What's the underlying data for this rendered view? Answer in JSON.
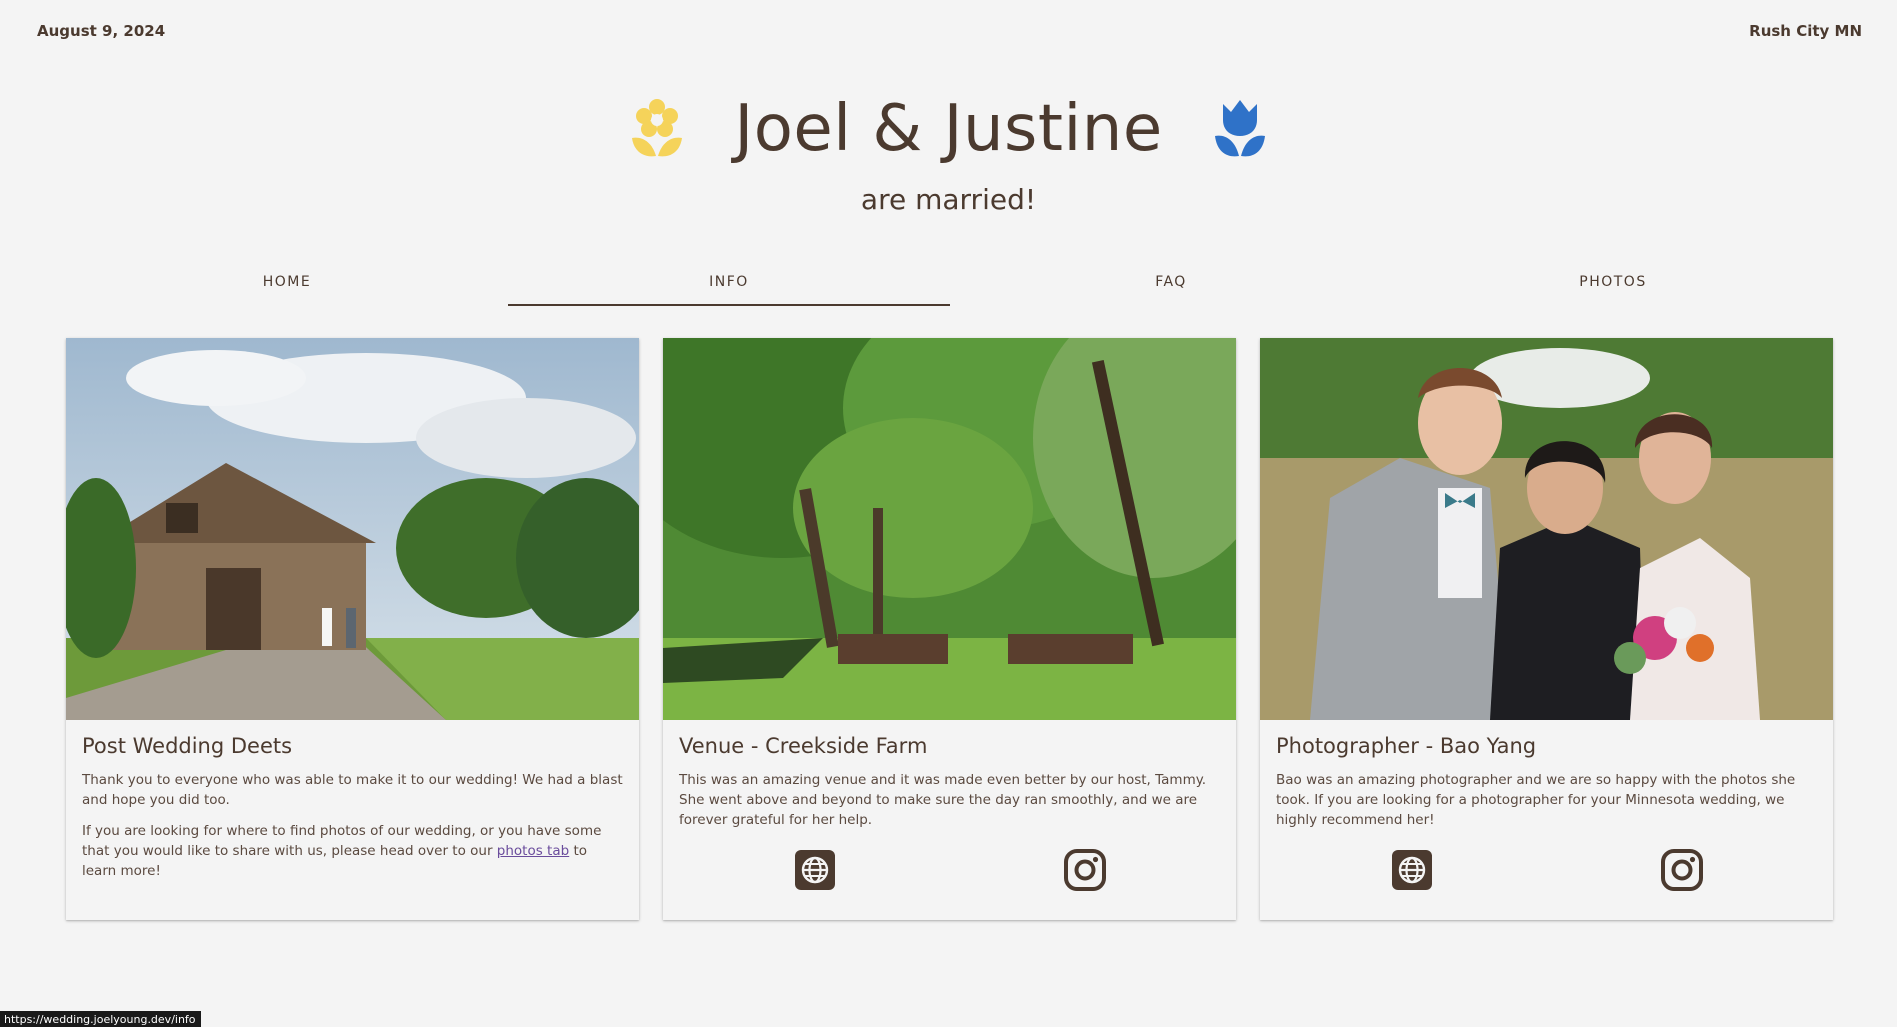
{
  "header": {
    "date": "August 9, 2024",
    "location": "Rush City MN"
  },
  "hero": {
    "title": "Joel & Justine",
    "subtitle": "are married!",
    "left_icon": "yellow-flower-icon",
    "right_icon": "blue-tulip-icon",
    "left_color": "#f5d35a",
    "right_color": "#2f72c8"
  },
  "nav": {
    "tabs": [
      {
        "label": "HOME"
      },
      {
        "label": "INFO"
      },
      {
        "label": "FAQ"
      },
      {
        "label": "PHOTOS"
      }
    ],
    "active_tab": "INFO"
  },
  "cards": [
    {
      "title": "Post Wedding Deets",
      "paragraph1": "Thank you to everyone who was able to make it to our wedding! We had a blast and hope you did too.",
      "paragraph2_before": "If you are looking for where to find photos of our wedding, or you have some that you would like to share with us, please head over to our ",
      "paragraph2_link": "photos tab",
      "paragraph2_after": " to learn more!"
    },
    {
      "title": "Venue - Creekside Farm",
      "paragraph1": "This was an amazing venue and it was made even better by our host, Tammy. She went above and beyond to make sure the day ran smoothly, and we are forever grateful for her help.",
      "icons": [
        "globe-icon",
        "instagram-icon"
      ]
    },
    {
      "title": "Photographer - Bao Yang",
      "paragraph1": "Bao was an amazing photographer and we are so happy with the photos she took. If you are looking for a photographer for your Minnesota wedding, we highly recommend her!",
      "icons": [
        "globe-icon",
        "instagram-icon"
      ]
    }
  ],
  "status_bar": {
    "url": "https://wedding.joelyoung.dev/info"
  },
  "colors": {
    "text": "#4b3a2f",
    "background": "#f4f4f4",
    "link": "#6a4c9c"
  }
}
